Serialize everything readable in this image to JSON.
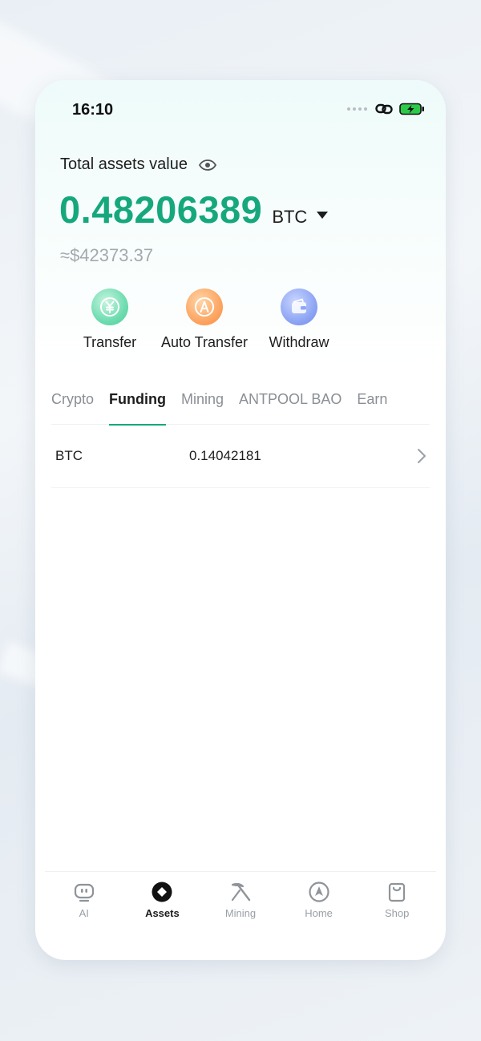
{
  "status_bar": {
    "time": "16:10"
  },
  "header": {
    "assets_label": "Total assets value",
    "balance": "0.48206389",
    "currency": "BTC",
    "usd_equivalent": "≈$42373.37"
  },
  "actions": [
    {
      "label": "Transfer",
      "icon": "transfer-yen-icon"
    },
    {
      "label": "Auto Transfer",
      "icon": "auto-transfer-icon"
    },
    {
      "label": "Withdraw",
      "icon": "wallet-icon"
    }
  ],
  "tabs": [
    {
      "label": "Crypto",
      "active": false
    },
    {
      "label": "Funding",
      "active": true
    },
    {
      "label": "Mining",
      "active": false
    },
    {
      "label": "ANTPOOL BAO",
      "active": false
    },
    {
      "label": "Earn",
      "active": false
    }
  ],
  "funding_list": [
    {
      "coin": "BTC",
      "amount": "0.14042181"
    }
  ],
  "bottom_nav": [
    {
      "label": "AI",
      "icon": "robot-icon",
      "active": false
    },
    {
      "label": "Assets",
      "icon": "assets-icon",
      "active": true
    },
    {
      "label": "Mining",
      "icon": "pickaxe-icon",
      "active": false
    },
    {
      "label": "Home",
      "icon": "home-icon",
      "active": false
    },
    {
      "label": "Shop",
      "icon": "shopping-bag-icon",
      "active": false
    }
  ],
  "colors": {
    "accent": "#16a87c",
    "text": "#1d1d1d",
    "muted": "#a5a9ae"
  }
}
